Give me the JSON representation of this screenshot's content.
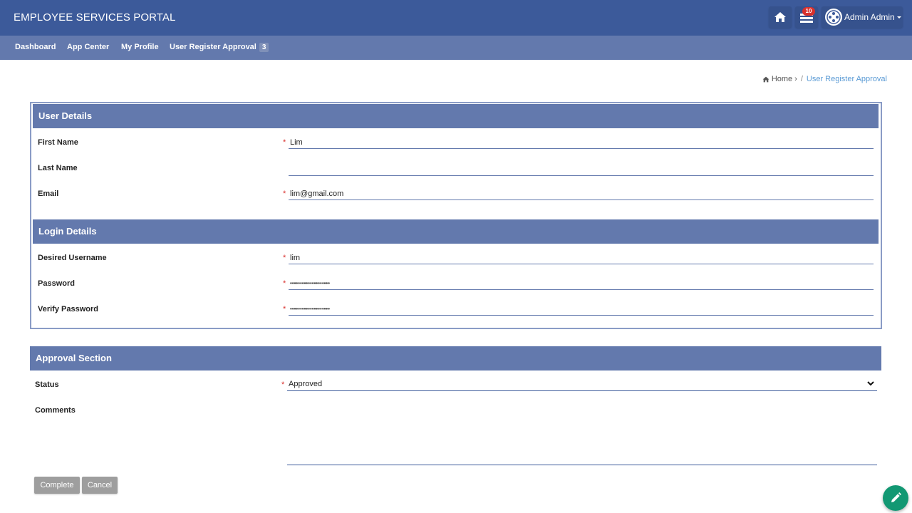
{
  "app": {
    "title": "EMPLOYEE SERVICES PORTAL"
  },
  "header": {
    "notification_count": "10",
    "user_name": "Admin Admin",
    "icons": [
      "home-icon",
      "notification-icon",
      "avatar"
    ]
  },
  "nav": {
    "items": [
      {
        "label": "Dashboard"
      },
      {
        "label": "App Center"
      },
      {
        "label": "My Profile"
      },
      {
        "label": "User Register Approval",
        "badge": "3"
      }
    ]
  },
  "breadcrumb": {
    "home": "Home",
    "separator": "/",
    "current": "User Register Approval"
  },
  "user_details": {
    "title": "User Details",
    "first_name": {
      "label": "First Name",
      "value": "Lim"
    },
    "last_name": {
      "label": "Last Name",
      "value": ""
    },
    "email": {
      "label": "Email",
      "value": "lim@gmail.com"
    }
  },
  "login_details": {
    "title": "Login Details",
    "username": {
      "label": "Desired Username",
      "value": "lim"
    },
    "password": {
      "label": "Password",
      "value": "••••••••••••••••••••"
    },
    "verify_password": {
      "label": "Verify Password",
      "value": "••••••••••••••••••••"
    }
  },
  "approval": {
    "title": "Approval Section",
    "status": {
      "label": "Status",
      "value": "Approved"
    },
    "comments": {
      "label": "Comments",
      "value": ""
    }
  },
  "required_marker": "*",
  "buttons": {
    "complete": "Complete",
    "cancel": "Cancel"
  },
  "colors": {
    "header": "#3c5a9a",
    "nav": "#6379ad",
    "section": "#6379ad",
    "required": "#d9302c",
    "fab": "#129873",
    "button": "#9e9e9e"
  }
}
